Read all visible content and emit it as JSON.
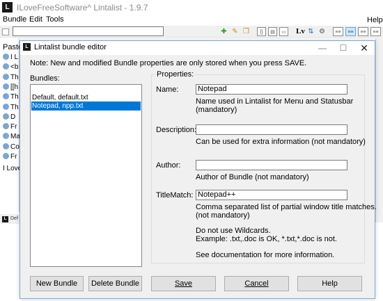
{
  "main_window": {
    "title": "ILoveFreeSoftware^ Lintalist - 1.9.7",
    "logo": "L",
    "menu": [
      "Bundle",
      "Edit",
      "Tools"
    ],
    "help": "Help",
    "tree_label": "Paste",
    "tree_rows": [
      "I L",
      "<b",
      "Th",
      "[[h",
      "Th",
      "Th",
      "D",
      "Fr",
      "Ma",
      "Co",
      "Fr"
    ],
    "text_preview": "I Love",
    "status_text": "Def"
  },
  "toolbar": {
    "icons": [
      "add-icon",
      "edit-icon",
      "copy-icon",
      "bracket-icon",
      "file-icon",
      "image-icon",
      "search-icon",
      "lv-icon",
      "sort-icon",
      "settings-icon",
      "view-1-icon",
      "view-2-icon",
      "view-3-icon",
      "view-4-icon",
      "view-5-icon"
    ],
    "lv_label": "Lv"
  },
  "dialog": {
    "title": "Lintalist bundle editor",
    "note": "Note: New and modified Bundle properties are only stored when you press SAVE.",
    "bundles_label": "Bundles:",
    "bundles": [
      {
        "label": "Default, default.txt",
        "selected": false
      },
      {
        "label": "Notepad, npp.txt",
        "selected": true
      }
    ],
    "properties_label": "Properties:",
    "fields": {
      "name": {
        "label": "Name:",
        "value": "Notepad",
        "hint_1": "Name used in Lintalist for Menu and Statusbar",
        "hint_2": "(mandatory)"
      },
      "description": {
        "label": "Description:",
        "value": "",
        "hint_1": "Can be used for extra information (not mandatory)"
      },
      "author": {
        "label": "Author:",
        "value": "",
        "hint_1": "Author of Bundle (not mandatory)"
      },
      "titlematch": {
        "label": "TitleMatch:",
        "value": "Notepad++",
        "hint_1": "Comma separated list of partial window title matches.",
        "hint_2": "(not mandatory)",
        "hint_3": "Do not use Wildcards.",
        "hint_4": "Example: .txt,.doc is OK, *.txt,*.doc is not.",
        "hint_5": "See documentation for more information."
      }
    },
    "buttons": {
      "new_bundle": "New Bundle",
      "delete_bundle": "Delete Bundle",
      "save": "Save",
      "cancel": "Cancel",
      "help": "Help"
    },
    "window_buttons": {
      "minimize": "—",
      "maximize": "☐",
      "close": "✕"
    }
  },
  "colors": {
    "selection": "#0078d7",
    "dialog_border": "#7aa6d6",
    "dialog_bg": "#f0f0f0"
  }
}
